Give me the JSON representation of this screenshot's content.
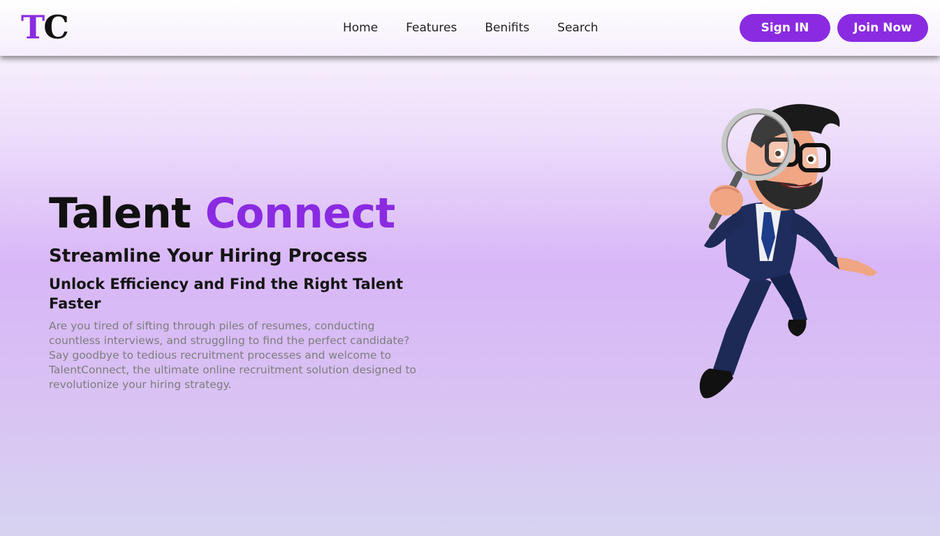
{
  "brand": {
    "logo_first": "T",
    "logo_second": "C",
    "accent_color": "#8a2be2"
  },
  "nav": {
    "links": [
      {
        "label": "Home"
      },
      {
        "label": "Features"
      },
      {
        "label": "Benifits"
      },
      {
        "label": "Search"
      }
    ]
  },
  "actions": {
    "signin_label": "Sign IN",
    "join_label": "Join Now"
  },
  "hero": {
    "title_part1": "Talent",
    "title_part2": "Connect",
    "subtitle": "Streamline Your Hiring Process",
    "tagline": "Unlock Efficiency and Find the Right Talent Faster",
    "body": "Are you tired of sifting through piles of resumes, conducting countless interviews, and struggling to find the perfect candidate? Say goodbye to tedious recruitment processes and welcome to TalentConnect, the ultimate online recruitment solution designed to revolutionize your hiring strategy."
  },
  "illustration": {
    "icon": "businessman-magnifying-glass-illustration"
  }
}
